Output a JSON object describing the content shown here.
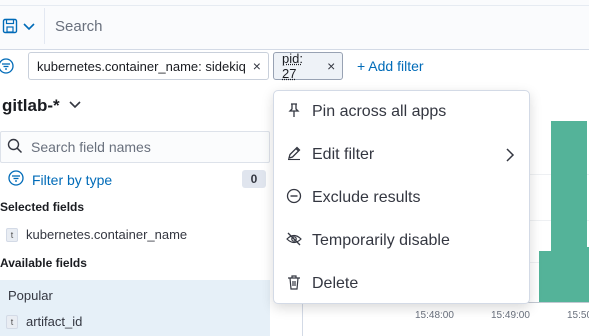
{
  "query_bar": {
    "language_icon": "save-query-icon",
    "dropdown_icon": "chevron-down-icon",
    "search_placeholder": "Search"
  },
  "filter_bar": {
    "filter_menu_icon": "filter-menu-icon",
    "filters": [
      {
        "label": "kubernetes.container_name: sidekiq",
        "remove_icon": "×"
      },
      {
        "label": "pid: 27",
        "remove_icon": "×"
      }
    ],
    "add_filter": "+ Add filter"
  },
  "sidebar": {
    "index_pattern": "gitlab-*",
    "field_search_placeholder": "Search field names",
    "filter_by_type": "Filter by type",
    "filter_count": "0",
    "selected_fields_title": "Selected fields",
    "selected_fields": [
      {
        "type": "t",
        "name": "kubernetes.container_name"
      }
    ],
    "available_fields_title": "Available fields",
    "popular_title": "Popular",
    "popular_fields": [
      {
        "type": "t",
        "name": "artifact_id"
      }
    ]
  },
  "chart": {
    "tick_labels": [
      "15:48:00",
      "15:49:00",
      "15:50"
    ],
    "bar_color": "#54b399"
  },
  "chart_data": {
    "type": "bar",
    "title": "",
    "xlabel": "",
    "ylabel": "",
    "categories": [
      "15:48:00",
      "15:49:00",
      "15:50"
    ],
    "x": [
      "15:48:40",
      "15:49:20",
      "15:49:40"
    ],
    "values": [
      36,
      128,
      39
    ],
    "ylim": [
      0,
      140
    ]
  },
  "context_menu": {
    "items": [
      {
        "icon": "pin-icon",
        "label": "Pin across all apps",
        "has_submenu": false
      },
      {
        "icon": "pencil-icon",
        "label": "Edit filter",
        "has_submenu": true
      },
      {
        "icon": "minus-circle-icon",
        "label": "Exclude results",
        "has_submenu": false
      },
      {
        "icon": "eye-closed-icon",
        "label": "Temporarily disable",
        "has_submenu": false
      },
      {
        "icon": "trash-icon",
        "label": "Delete",
        "has_submenu": false
      }
    ]
  },
  "colors": {
    "accent": "#006bb8",
    "bar": "#54b399",
    "border": "#d3dae6"
  }
}
